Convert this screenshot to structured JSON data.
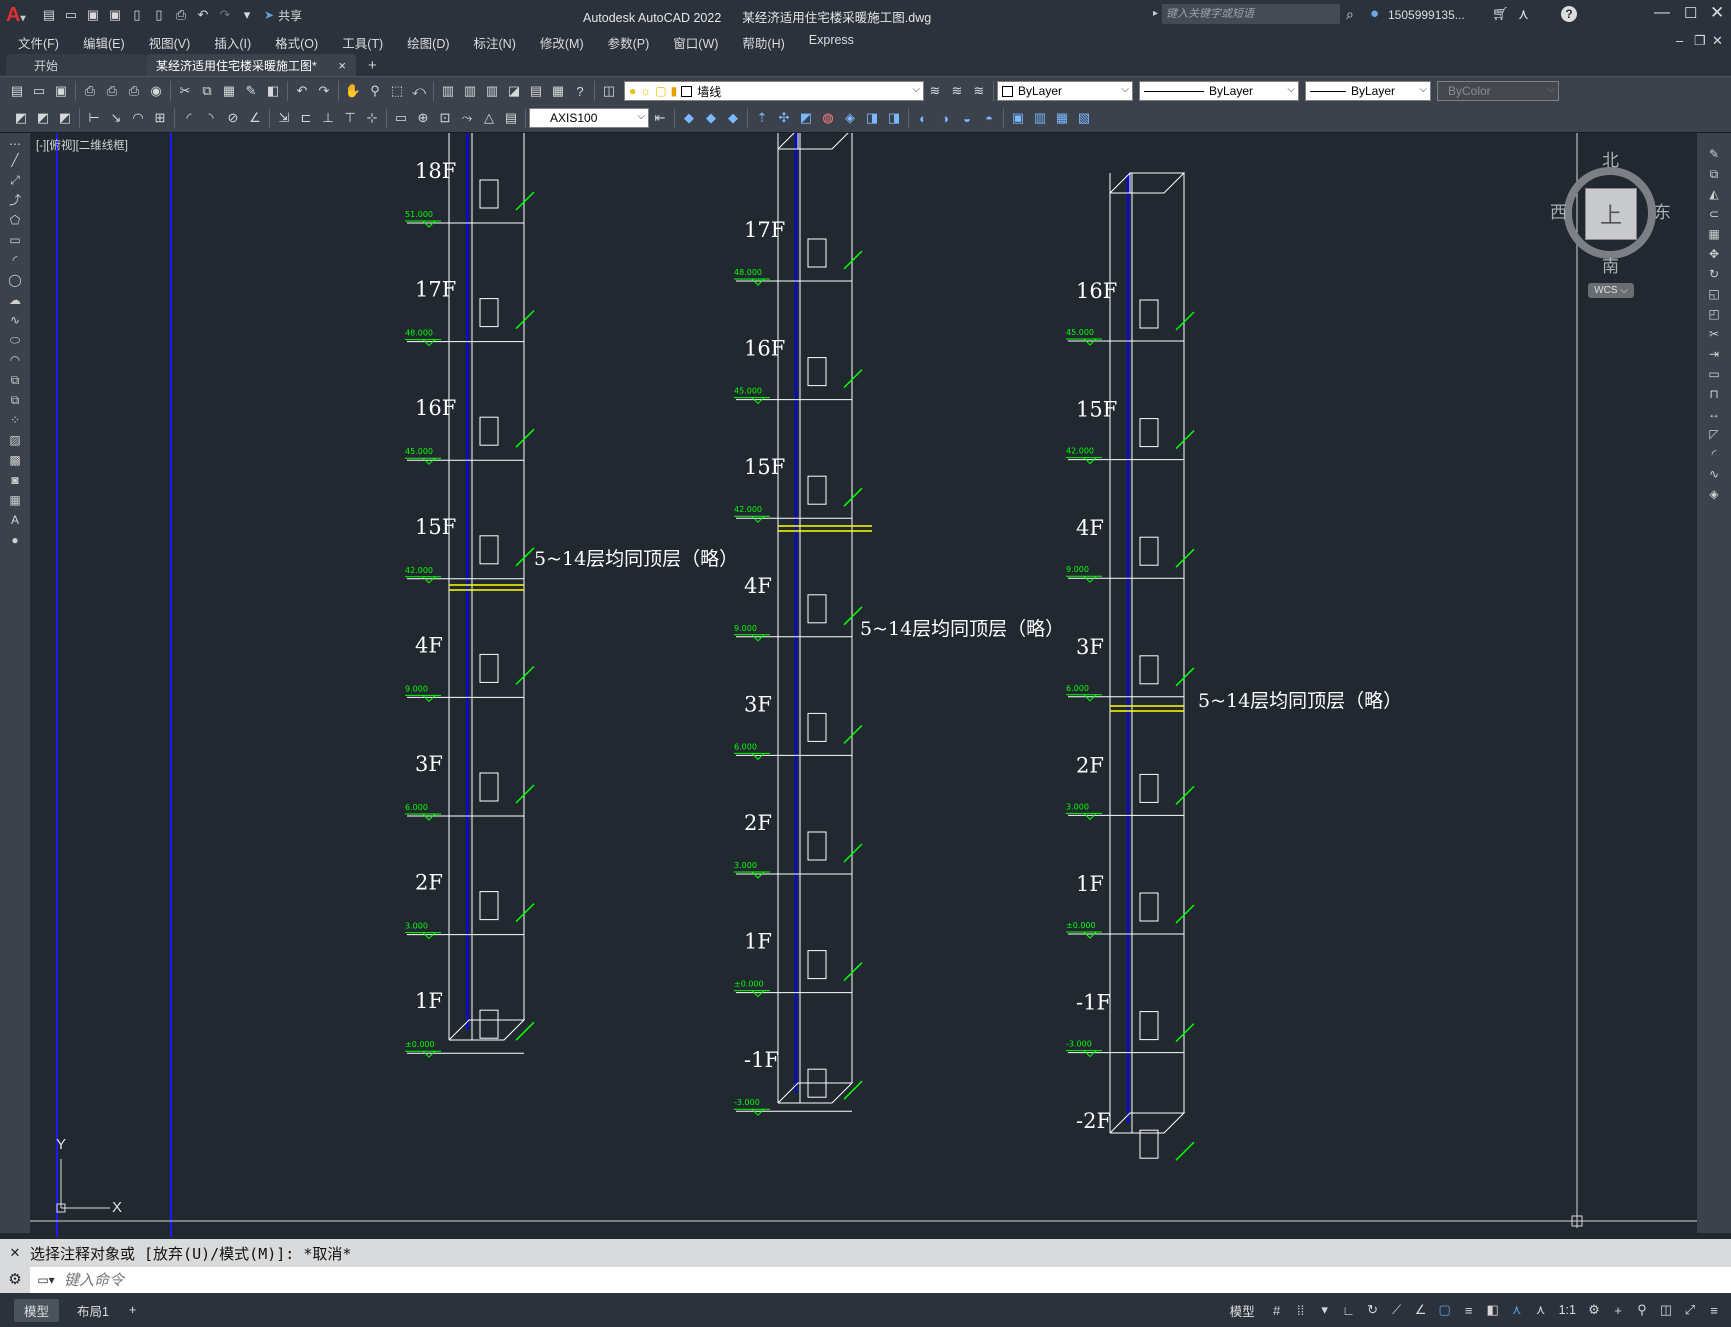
{
  "titlebar": {
    "app_title": "Autodesk AutoCAD 2022",
    "file_title": "某经济适用住宅楼采暖施工图.dwg",
    "share_label": "共享",
    "search_placeholder": "键入关键字或短语",
    "user_label": "1505999135...",
    "help_label": "?"
  },
  "menubar": {
    "items": [
      "文件(F)",
      "编辑(E)",
      "视图(V)",
      "插入(I)",
      "格式(O)",
      "工具(T)",
      "绘图(D)",
      "标注(N)",
      "修改(M)",
      "参数(P)",
      "窗口(W)",
      "帮助(H)",
      "Express"
    ]
  },
  "tabs": {
    "start": "开始",
    "active": "某经济适用住宅楼采暖施工图*",
    "close": "×",
    "add": "+"
  },
  "toolbar1": {
    "layer_name": "墙线",
    "color": "ByLayer",
    "linetype": "ByLayer",
    "lineweight": "ByLayer",
    "plotstyle": "ByColor"
  },
  "toolbar2": {
    "dimstyle": "AXIS100"
  },
  "viewport": {
    "label": "[-][俯视][二维线框]",
    "ucs_x": "X",
    "ucs_y": "Y"
  },
  "viewcube": {
    "north": "北",
    "south": "南",
    "east": "东",
    "west": "西",
    "face": "上",
    "wcs": "WCS"
  },
  "drawing": {
    "colors": {
      "line": "#ffffff",
      "pipe": "#0000ff",
      "dim": "#00ff00",
      "break": "#ffff00",
      "bg": "#212830"
    },
    "note": "5~14层均同顶层（略）",
    "columns": [
      {
        "floors": [
          "18F",
          "17F",
          "16F",
          "15F",
          "4F",
          "3F",
          "2F",
          "1F"
        ],
        "elevations": [
          "51.000",
          "48.000",
          "45.000",
          "42.000",
          "9.000",
          "6.000",
          "3.000",
          "±0.000"
        ]
      },
      {
        "floors": [
          "17F",
          "16F",
          "15F",
          "4F",
          "3F",
          "2F",
          "1F",
          "-1F"
        ],
        "elevations": [
          "48.000",
          "45.000",
          "42.000",
          "9.000",
          "6.000",
          "3.000",
          "±0.000",
          "-3.000"
        ]
      },
      {
        "floors": [
          "16F",
          "15F",
          "4F",
          "3F",
          "2F",
          "1F",
          "-1F",
          "-2F"
        ],
        "elevations": [
          "45.000",
          "42.000",
          "9.000",
          "6.000",
          "3.000",
          "±0.000",
          "-3.000"
        ]
      }
    ]
  },
  "command": {
    "history": "选择注释对象或 [放弃(U)/模式(M)]: *取消*",
    "placeholder": "键入命令"
  },
  "status": {
    "model_tab": "模型",
    "layout_tab": "布局1",
    "add": "+",
    "model_btn": "模型",
    "scale": "1:1"
  }
}
